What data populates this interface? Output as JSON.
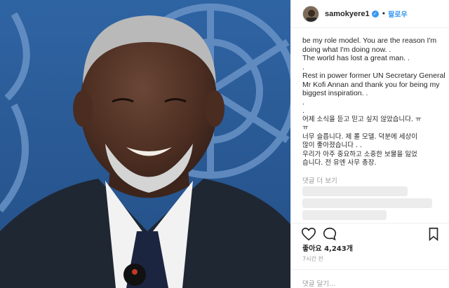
{
  "header": {
    "username": "samokyere1",
    "verified_icon": "verified-badge-icon",
    "separator": "•",
    "follow_label": "팔로우"
  },
  "caption": {
    "lines": [
      "be my role model. You are the reason I'm",
      "doing what I'm doing now. .",
      "The world has lost a great man. .",
      ".",
      "Rest in power former UN Secretary General",
      "Mr Kofi Annan and thank you for being my",
      "biggest inspiration. .",
      ".",
      ".",
      "어제 소식을 듣고 믿고 싶지 않았습니다. ㅠ",
      "ㅠ",
      "너무 슬픕니다. 제 롤 모델. 덕분에 세상이",
      "많이 좋아졌습니다 . .",
      "우리가 아주 중요하고 소중한 보물을 잃었",
      "습니다. 전 유엔 사무 총장."
    ]
  },
  "comments": {
    "more_label": "댓글 더 보기"
  },
  "actions": {
    "like_icon": "heart-icon",
    "comment_icon": "comment-icon",
    "save_icon": "bookmark-icon"
  },
  "likes": "좋아요 4,243개",
  "time": "7시간 전",
  "comment_box": {
    "placeholder": "댓글 달기..."
  },
  "colors": {
    "follow_blue": "#3897f0",
    "photo_bg": "#2e5f9c"
  }
}
